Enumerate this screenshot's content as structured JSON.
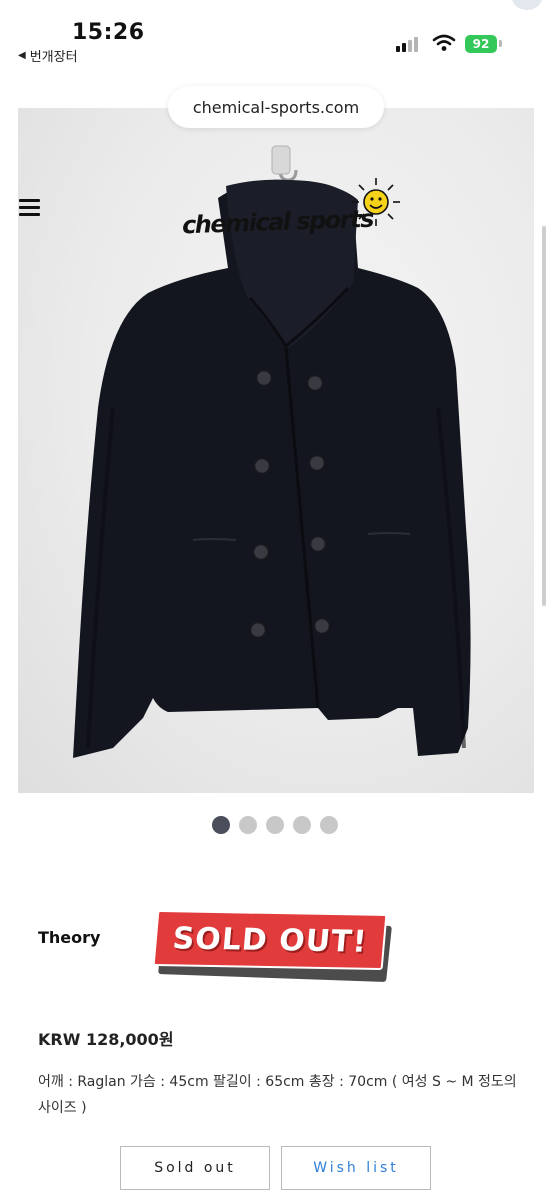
{
  "status_bar": {
    "time": "15:26",
    "back_app": "번개장터",
    "battery": "92"
  },
  "browser": {
    "url": "chemical-sports.com"
  },
  "header": {
    "logo": "chemical sports"
  },
  "carousel": {
    "count": 5,
    "active_index": 0
  },
  "product": {
    "brand": "Theory",
    "badge": "SOLD OUT!",
    "price": "KRW 128,000원",
    "description": "어깨 : Raglan 가슴 : 45cm 팔길이 : 65cm 총장 : 70cm ( 여성 S ~ M 정도의 사이즈 )"
  },
  "actions": {
    "sold_out_label": "Sold out",
    "wish_list_label": "Wish list"
  },
  "colors": {
    "accent_blue": "#2f7fd8",
    "sold_red": "#e23b3b",
    "battery_green": "#34c759",
    "dot_active": "#4a4d5a"
  },
  "icons": [
    "menu-icon",
    "back-arrow-icon",
    "cellular-signal-icon",
    "wifi-icon",
    "battery-icon",
    "smiley-sun-icon"
  ]
}
